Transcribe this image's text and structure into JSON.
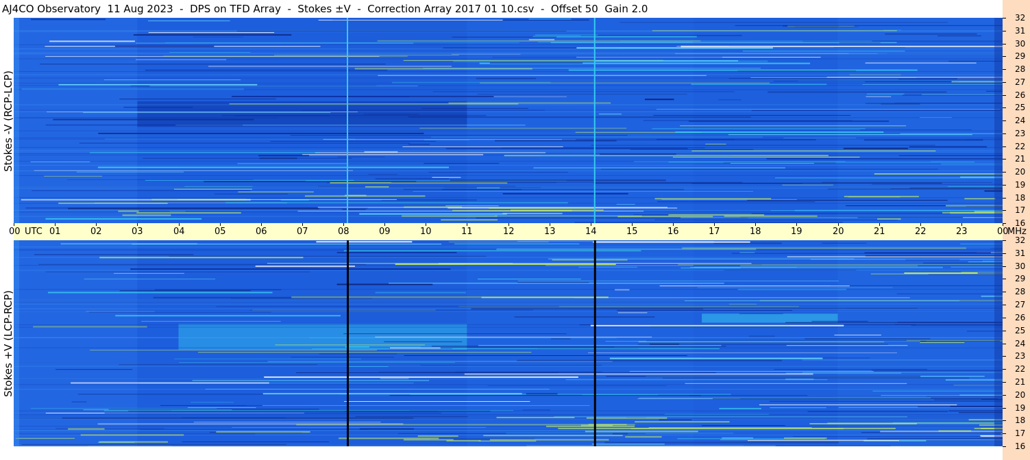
{
  "title": "AJ4CO Observatory  11 Aug 2023  -  DPS on TFD Array  -  Stokes ±V  -  Correction Array 2017 01 10.csv  -  Offset 50  Gain 2.0",
  "chart_data": [
    {
      "type": "heatmap",
      "title": "AJ4CO Observatory  11 Aug 2023  -  DPS on TFD Array  -  Stokes ±V  -  Correction Array 2017 01 10.csv  -  Offset 50  Gain 2.0",
      "ylabel": "Stokes -V (RCP-LCP)",
      "yunit": "MHz",
      "ylim": [
        16,
        32
      ],
      "yticks": [
        "32",
        "31",
        "30",
        "29",
        "28",
        "27",
        "26",
        "25",
        "24",
        "23",
        "22",
        "21",
        "20",
        "19",
        "18",
        "17",
        "16"
      ],
      "xlim": [
        0,
        24
      ],
      "vertical_markers_utc": [
        8.1,
        14.1
      ],
      "marker_color": "#33ccee",
      "colormap": [
        "#0a2a9a",
        "#1a55dd",
        "#2a7ae8",
        "#3ad0f0",
        "#c8f060",
        "#ffffff"
      ]
    },
    {
      "type": "heatmap",
      "ylabel": "Stokes +V (LCP-RCP)",
      "yunit": "MHz",
      "ylim": [
        16,
        32
      ],
      "yticks": [
        "32",
        "31",
        "30",
        "29",
        "28",
        "27",
        "26",
        "25",
        "24",
        "23",
        "22",
        "21",
        "20",
        "19",
        "18",
        "17",
        "16"
      ],
      "xlim": [
        0,
        24
      ],
      "vertical_markers_utc": [
        8.1,
        14.1
      ],
      "marker_color": "#000000",
      "colormap": [
        "#0a2a9a",
        "#1a55dd",
        "#2a7ae8",
        "#3ad0f0",
        "#c8f060",
        "#ffffff"
      ]
    }
  ],
  "x_axis": {
    "labels": [
      "00",
      "01",
      "02",
      "03",
      "04",
      "05",
      "06",
      "07",
      "08",
      "09",
      "10",
      "11",
      "12",
      "13",
      "14",
      "15",
      "16",
      "17",
      "18",
      "19",
      "20",
      "21",
      "22",
      "23",
      "00"
    ],
    "utc_label": "UTC",
    "unit_label": "MHz"
  },
  "colors": {
    "band": "#ffffcc",
    "right_axis": "#fddcbf",
    "base_blue": "#1f63e0"
  }
}
